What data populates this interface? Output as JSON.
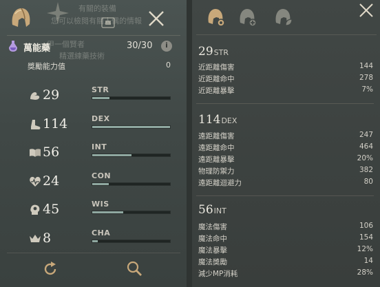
{
  "left_panel": {
    "background_text": [
      "有關的裝備",
      "您可以檢閱有關人偶的情報",
      "甲一個賢者",
      "精選練藥技術"
    ],
    "elixir": {
      "name": "萬能藥",
      "count": "30/30",
      "info_glyph": "i"
    },
    "bonus": {
      "label": "獎勵能力值",
      "value": "0"
    },
    "stats": [
      {
        "abbr": "STR",
        "value": "29",
        "icon": "arm-icon",
        "fill": 0.22
      },
      {
        "abbr": "DEX",
        "value": "114",
        "icon": "boot-icon",
        "fill": 1.0
      },
      {
        "abbr": "INT",
        "value": "56",
        "icon": "book-icon",
        "fill": 0.5
      },
      {
        "abbr": "CON",
        "value": "24",
        "icon": "heart-icon",
        "fill": 0.21
      },
      {
        "abbr": "WIS",
        "value": "45",
        "icon": "head-icon",
        "fill": 0.4
      },
      {
        "abbr": "CHA",
        "value": "8",
        "icon": "crown-icon",
        "fill": 0.07
      }
    ],
    "footer": {
      "reset_icon": "refresh-icon",
      "search_icon": "magnifier-icon"
    }
  },
  "right_panel": {
    "tabs": [
      "helmet-gear-icon",
      "helmet-plus-icon",
      "helmet-leaf-icon"
    ],
    "sections": [
      {
        "value": "29",
        "abbr": "STR",
        "lines": [
          {
            "label": "近距離傷害",
            "value": "144"
          },
          {
            "label": "近距離命中",
            "value": "278"
          },
          {
            "label": "近距離暴擊",
            "value": "7%"
          }
        ]
      },
      {
        "value": "114",
        "abbr": "DEX",
        "lines": [
          {
            "label": "遠距離傷害",
            "value": "247"
          },
          {
            "label": "遠距離命中",
            "value": "464"
          },
          {
            "label": "遠距離暴擊",
            "value": "20%"
          },
          {
            "label": "物理防禦力",
            "value": "382"
          },
          {
            "label": "遠距離迴避力",
            "value": "80"
          }
        ]
      },
      {
        "value": "56",
        "abbr": "INT",
        "lines": [
          {
            "label": "魔法傷害",
            "value": "106"
          },
          {
            "label": "魔法命中",
            "value": "154"
          },
          {
            "label": "魔法暴擊",
            "value": "12%"
          },
          {
            "label": "魔法獎勵",
            "value": "14"
          },
          {
            "label": "減少MP消耗",
            "value": "28%"
          }
        ]
      }
    ]
  },
  "colors": {
    "accent_gold": "#c8a87a",
    "bar_fill": "#8fa8a0",
    "panel_bg": "#414745"
  }
}
